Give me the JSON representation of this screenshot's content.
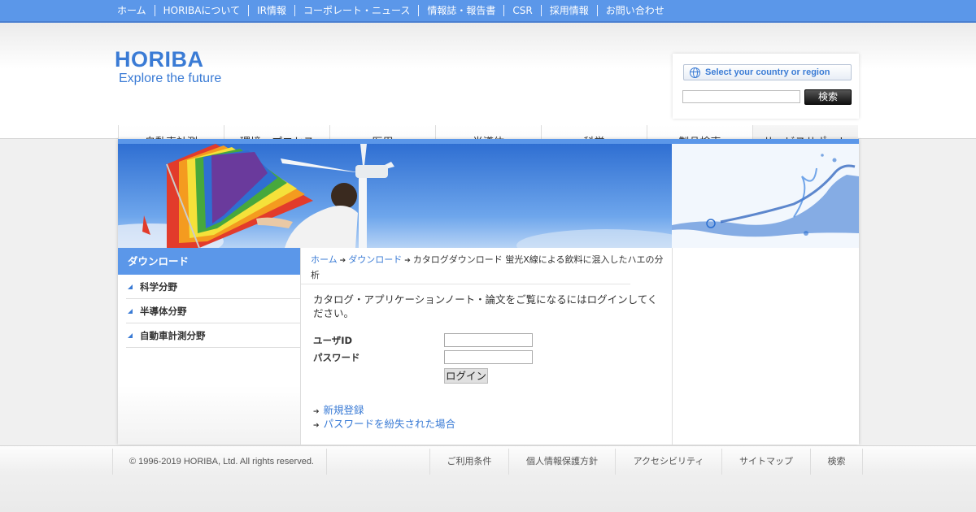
{
  "top_nav": [
    "ホーム",
    "HORIBAについて",
    "IR情報",
    "コーポレート・ニュース",
    "情報誌・報告書",
    "CSR",
    "採用情報",
    "お問い合わせ"
  ],
  "logo": {
    "name": "HORIBA",
    "tagline": "Explore the future"
  },
  "region_selector": {
    "label": "Select your country or region"
  },
  "search": {
    "button": "検索",
    "placeholder": ""
  },
  "main_nav": [
    "自動車計測",
    "環境・プロセス",
    "医用",
    "半導体",
    "科学",
    "製品検索",
    "サービスサポート"
  ],
  "sidebar": {
    "title": "ダウンロード",
    "items": [
      "科学分野",
      "半導体分野",
      "自動車計測分野"
    ]
  },
  "breadcrumb": {
    "home": "ホーム",
    "download": "ダウンロード",
    "current": "カタログダウンロード  蛍光X線による飲料に混入したハエの分析"
  },
  "login": {
    "intro": "カタログ・アプリケーションノート・論文をご覧になるにはログインしてください。",
    "user_label": "ユーザID",
    "password_label": "パスワード",
    "user_value": "",
    "password_value": "",
    "button": "ログイン"
  },
  "links": {
    "register": "新規登録",
    "lost_password": "パスワードを紛失された場合"
  },
  "footer": {
    "copyright": "© 1996-2019 HORIBA, Ltd. All rights reserved.",
    "nav": [
      "ご利用条件",
      "個人情報保護方針",
      "アクセシビリティ",
      "サイトマップ",
      "検索"
    ]
  },
  "colors": {
    "accent": "#5b97e9",
    "link": "#3a7bd5",
    "logo": "#3a7bd5"
  }
}
